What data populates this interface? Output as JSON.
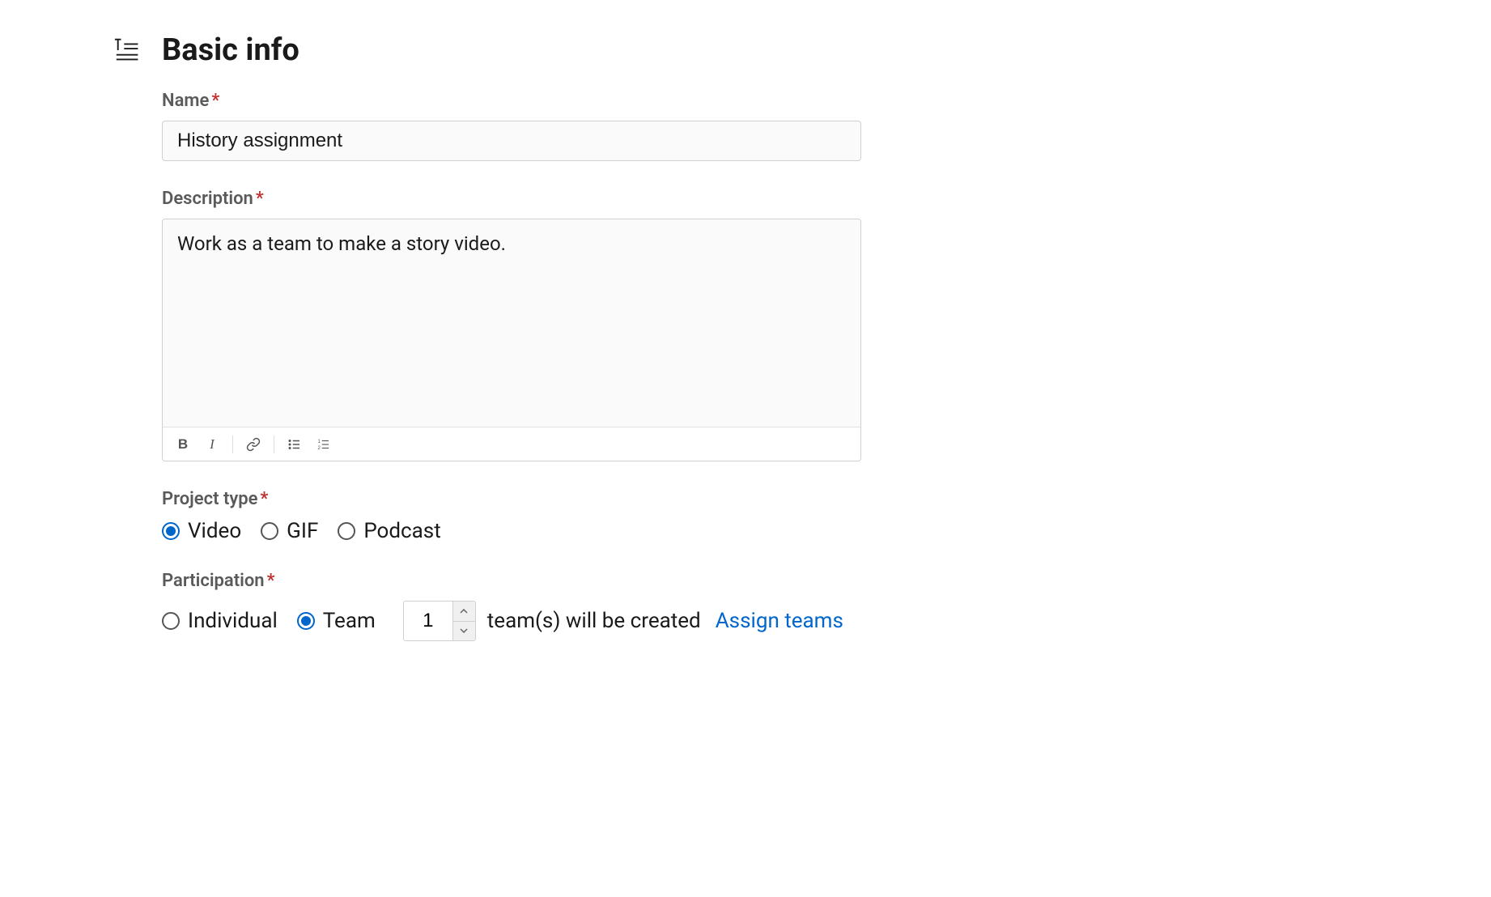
{
  "section": {
    "title": "Basic info"
  },
  "fields": {
    "name": {
      "label": "Name",
      "value": "History assignment"
    },
    "description": {
      "label": "Description",
      "value": "Work as a team to make a story video."
    },
    "project_type": {
      "label": "Project type",
      "options": [
        "Video",
        "GIF",
        "Podcast"
      ],
      "selected": "Video"
    },
    "participation": {
      "label": "Participation",
      "options": [
        "Individual",
        "Team"
      ],
      "selected": "Team",
      "team_count": "1",
      "teams_created_text": "team(s) will be created",
      "assign_link": "Assign teams"
    }
  }
}
